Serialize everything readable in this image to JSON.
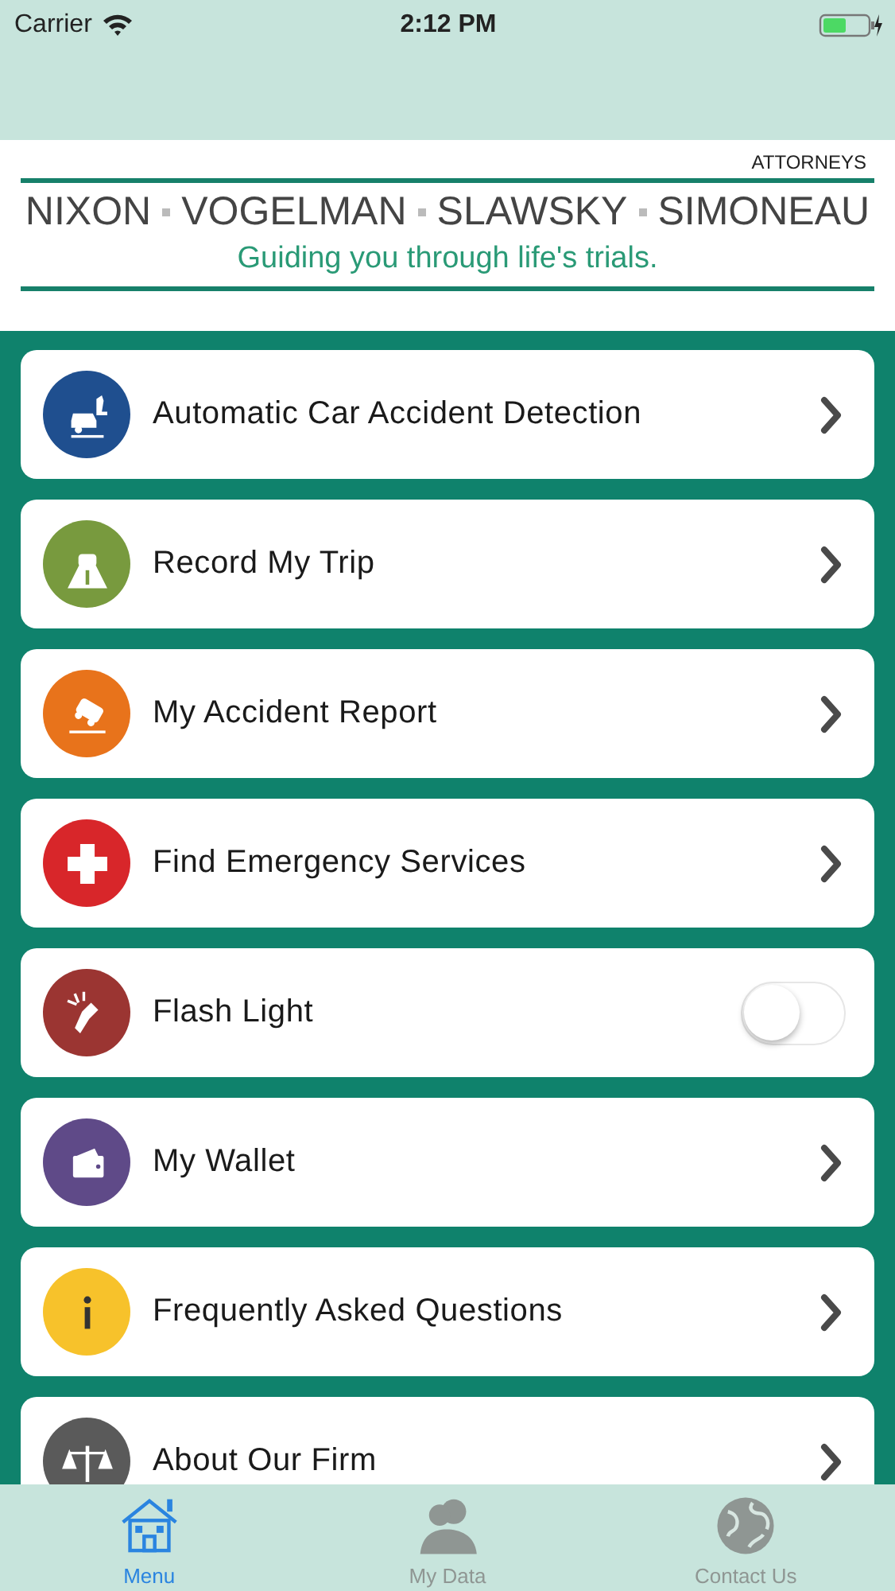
{
  "status_bar": {
    "carrier": "Carrier",
    "time": "2:12 PM"
  },
  "header": {
    "attorneys": "ATTORNEYS",
    "names": [
      "NIXON",
      "VOGELMAN",
      "SLAWSKY",
      "SIMONEAU"
    ],
    "tagline": "Guiding you through life's trials."
  },
  "menu_items": [
    {
      "label": "Automatic Car Accident Detection",
      "kind": "link",
      "color": "#1f4f8f"
    },
    {
      "label": "Record My Trip",
      "kind": "link",
      "color": "#789a3e"
    },
    {
      "label": "My Accident Report",
      "kind": "link",
      "color": "#e8731b"
    },
    {
      "label": "Find Emergency Services",
      "kind": "link",
      "color": "#d8262a"
    },
    {
      "label": "Flash Light",
      "kind": "toggle",
      "color": "#9b3532",
      "on": false
    },
    {
      "label": "My Wallet",
      "kind": "link",
      "color": "#5f4a88"
    },
    {
      "label": "Frequently Asked Questions",
      "kind": "link",
      "color": "#f7c22b"
    },
    {
      "label": "About Our Firm",
      "kind": "link",
      "color": "#5a5a5a"
    }
  ],
  "tabs": [
    {
      "label": "Menu",
      "selected": true
    },
    {
      "label": "My Data",
      "selected": false
    },
    {
      "label": "Contact Us",
      "selected": false
    }
  ]
}
